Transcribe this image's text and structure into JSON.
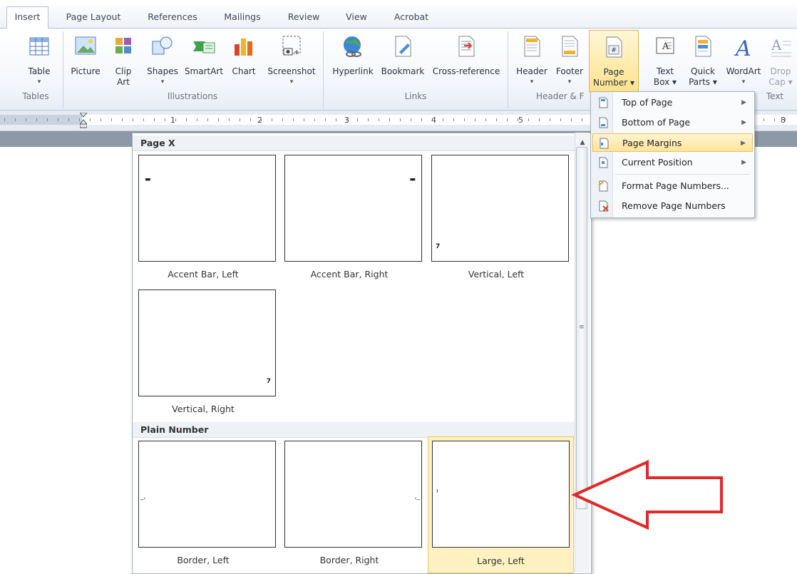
{
  "tabs": [
    "Insert",
    "Page Layout",
    "References",
    "Mailings",
    "Review",
    "View",
    "Acrobat"
  ],
  "ribbon": {
    "groups": {
      "tables": "Tables",
      "illustrations": "Illustrations",
      "links": "Links",
      "header_footer": "Header & F",
      "text": "Text"
    },
    "buttons": {
      "table": "Table",
      "picture": "Picture",
      "clip_art_1": "Clip",
      "clip_art_2": "Art",
      "shapes": "Shapes",
      "smartart": "SmartArt",
      "chart": "Chart",
      "screenshot": "Screenshot",
      "hyperlink": "Hyperlink",
      "bookmark": "Bookmark",
      "cross_reference": "Cross-reference",
      "header": "Header",
      "footer": "Footer",
      "page_number_1": "Page",
      "page_number_2": "Number",
      "text_box_1": "Text",
      "text_box_2": "Box",
      "quick_parts_1": "Quick",
      "quick_parts_2": "Parts",
      "wordart": "WordArt",
      "drop_cap_1": "Drop",
      "drop_cap_2": "Cap"
    }
  },
  "ruler": {
    "numbers": [
      "1",
      "2",
      "3",
      "4",
      "5",
      "8"
    ]
  },
  "gallery": {
    "sections": {
      "page_x": "Page X",
      "plain_number": "Plain Number"
    },
    "items": {
      "accent_left": "Accent Bar, Left",
      "accent_right": "Accent Bar, Right",
      "vertical_left": "Vertical, Left",
      "vertical_right": "Vertical, Right",
      "border_left": "Border, Left",
      "border_right": "Border, Right",
      "large_left": "Large, Left"
    }
  },
  "menu": {
    "items": [
      {
        "label": "Top of Page",
        "icon": "page-top-icon"
      },
      {
        "label": "Bottom of Page",
        "icon": "page-bottom-icon"
      },
      {
        "label": "Page Margins",
        "icon": "page-margins-icon"
      },
      {
        "label": "Current Position",
        "icon": "current-position-icon"
      },
      {
        "label": "Format Page Numbers...",
        "icon": "format-page-numbers-icon"
      },
      {
        "label": "Remove Page Numbers",
        "icon": "remove-page-numbers-icon"
      }
    ]
  },
  "colors": {
    "accent": "#ffe28a",
    "arrow": "#e02a2a",
    "selection": "#fff1c2"
  }
}
